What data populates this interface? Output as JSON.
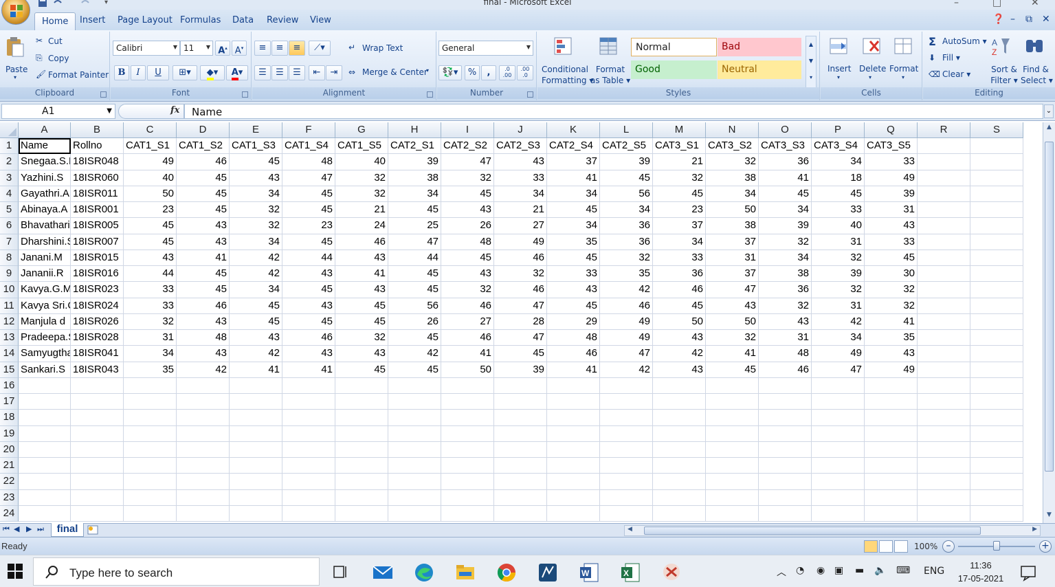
{
  "window": {
    "title": "final - Microsoft Excel"
  },
  "tabs": [
    "Home",
    "Insert",
    "Page Layout",
    "Formulas",
    "Data",
    "Review",
    "View"
  ],
  "ribbon": {
    "clipboard": {
      "label": "Clipboard",
      "paste": "Paste",
      "cut": "Cut",
      "copy": "Copy",
      "format_painter": "Format Painter"
    },
    "font": {
      "label": "Font",
      "name": "Calibri",
      "size": "11",
      "bold": "B",
      "italic": "I",
      "underline": "U"
    },
    "alignment": {
      "label": "Alignment",
      "wrap_text": "Wrap Text",
      "merge_center": "Merge & Center"
    },
    "number": {
      "label": "Number",
      "format": "General",
      "percent": "%",
      "comma": ",",
      "inc_decimal": ".0 .00",
      "dec_decimal": ".00 .0"
    },
    "styles": {
      "label": "Styles",
      "conditional": [
        "Conditional",
        "Formatting"
      ],
      "format_table": [
        "Format",
        "as Table"
      ],
      "normal": "Normal",
      "bad": "Bad",
      "good": "Good",
      "neutral": "Neutral"
    },
    "cells": {
      "label": "Cells",
      "insert": "Insert",
      "delete": "Delete",
      "format": "Format"
    },
    "editing": {
      "label": "Editing",
      "autosum": "AutoSum",
      "fill": "Fill",
      "clear": "Clear",
      "sort_filter": [
        "Sort &",
        "Filter"
      ],
      "find_select": [
        "Find &",
        "Select"
      ]
    }
  },
  "formula_bar": {
    "name_box": "A1",
    "fx": "fx",
    "content": "Name"
  },
  "columns": [
    "A",
    "B",
    "C",
    "D",
    "E",
    "F",
    "G",
    "H",
    "I",
    "J",
    "K",
    "L",
    "M",
    "N",
    "O",
    "P",
    "Q",
    "R",
    "S"
  ],
  "row_numbers": [
    "1",
    "2",
    "3",
    "4",
    "5",
    "6",
    "7",
    "8",
    "9",
    "10",
    "11",
    "12",
    "13",
    "14",
    "15",
    "16",
    "17",
    "18",
    "19",
    "20",
    "21",
    "22",
    "23",
    "24"
  ],
  "sheet": {
    "header": [
      "Name",
      "Rollno",
      "CAT1_S1",
      "CAT1_S2",
      "CAT1_S3",
      "CAT1_S4",
      "CAT1_S5",
      "CAT2_S1",
      "CAT2_S2",
      "CAT2_S3",
      "CAT2_S4",
      "CAT2_S5",
      "CAT3_S1",
      "CAT3_S2",
      "CAT3_S3",
      "CAT3_S4",
      "CAT3_S5"
    ],
    "rows": [
      [
        "Snegaa.S.R",
        "18ISR048",
        "49",
        "46",
        "45",
        "48",
        "40",
        "39",
        "47",
        "43",
        "37",
        "39",
        "21",
        "32",
        "36",
        "34",
        "33"
      ],
      [
        "Yazhini.S",
        "18ISR060",
        "40",
        "45",
        "43",
        "47",
        "32",
        "38",
        "32",
        "33",
        "41",
        "45",
        "32",
        "38",
        "41",
        "18",
        "49"
      ],
      [
        "Gayathri.A",
        "18ISR011",
        "50",
        "45",
        "34",
        "45",
        "32",
        "34",
        "45",
        "34",
        "34",
        "56",
        "45",
        "34",
        "45",
        "45",
        "39"
      ],
      [
        "Abinaya.A",
        "18ISR001",
        "23",
        "45",
        "32",
        "45",
        "21",
        "45",
        "43",
        "21",
        "45",
        "34",
        "23",
        "50",
        "34",
        "33",
        "31"
      ],
      [
        "Bhavatharini",
        "18ISR005",
        "45",
        "43",
        "32",
        "23",
        "24",
        "25",
        "26",
        "27",
        "34",
        "36",
        "37",
        "38",
        "39",
        "40",
        "43"
      ],
      [
        "Dharshini.S",
        "18ISR007",
        "45",
        "43",
        "34",
        "45",
        "46",
        "47",
        "48",
        "49",
        "35",
        "36",
        "34",
        "37",
        "32",
        "31",
        "33"
      ],
      [
        "Janani.M",
        "18ISR015",
        "43",
        "41",
        "42",
        "44",
        "43",
        "44",
        "45",
        "46",
        "45",
        "32",
        "33",
        "31",
        "34",
        "32",
        "45"
      ],
      [
        "Jananii.R",
        "18ISR016",
        "44",
        "45",
        "42",
        "43",
        "41",
        "45",
        "43",
        "32",
        "33",
        "35",
        "36",
        "37",
        "38",
        "39",
        "30"
      ],
      [
        "Kavya.G.M",
        "18ISR023",
        "33",
        "45",
        "34",
        "45",
        "43",
        "45",
        "32",
        "46",
        "43",
        "42",
        "46",
        "47",
        "36",
        "32",
        "32"
      ],
      [
        "Kavya Sri.C",
        "18ISR024",
        "33",
        "46",
        "45",
        "43",
        "45",
        "56",
        "46",
        "47",
        "45",
        "46",
        "45",
        "43",
        "32",
        "31",
        "32"
      ],
      [
        "Manjula d",
        "18ISR026",
        "32",
        "43",
        "45",
        "45",
        "45",
        "26",
        "27",
        "28",
        "29",
        "49",
        "50",
        "50",
        "43",
        "42",
        "41"
      ],
      [
        "Pradeepa.S",
        "18ISR028",
        "31",
        "48",
        "43",
        "46",
        "32",
        "45",
        "46",
        "47",
        "48",
        "49",
        "43",
        "32",
        "31",
        "34",
        "35"
      ],
      [
        "Samyugtha",
        "18ISR041",
        "34",
        "43",
        "42",
        "43",
        "43",
        "42",
        "41",
        "45",
        "46",
        "47",
        "42",
        "41",
        "48",
        "49",
        "43"
      ],
      [
        "Sankari.S",
        "18ISR043",
        "35",
        "42",
        "41",
        "41",
        "45",
        "45",
        "50",
        "39",
        "41",
        "42",
        "43",
        "45",
        "46",
        "47",
        "49"
      ]
    ],
    "tab_name": "final"
  },
  "status": {
    "text": "Ready",
    "zoom": "100%"
  },
  "taskbar": {
    "search_placeholder": "Type here to search",
    "language": "ENG",
    "time": "11:36",
    "date": "17-05-2021"
  },
  "colors": {
    "accent": "#15428b",
    "bad_bg": "#ffc7ce",
    "bad_fg": "#9c0006",
    "good_bg": "#c6efce",
    "good_fg": "#006100",
    "neutral_bg": "#ffeb9c",
    "neutral_fg": "#9c6500"
  }
}
